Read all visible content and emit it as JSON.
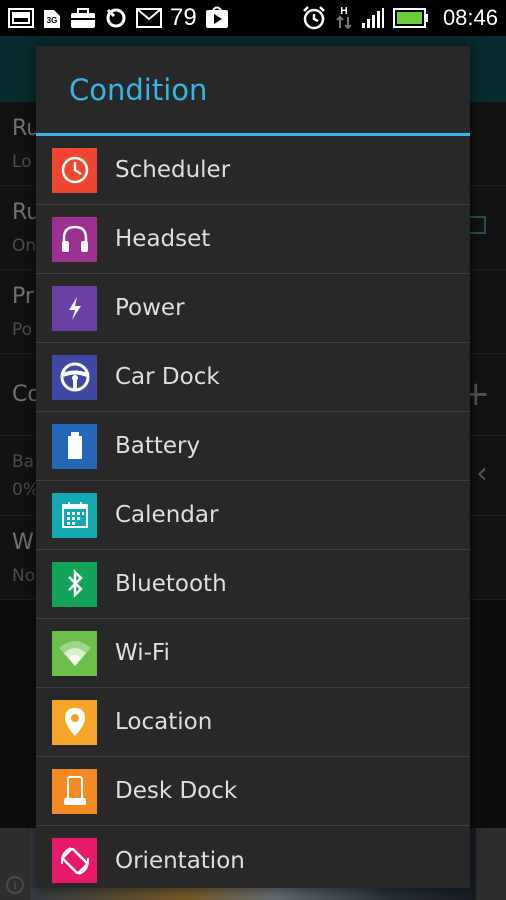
{
  "statusbar": {
    "notification_count": "79",
    "time": "08:46",
    "network_badge": "3G",
    "hspa_label": "H"
  },
  "background": {
    "rows": [
      {
        "title": "Ru",
        "sub": "Lo"
      },
      {
        "title": "Ru",
        "sub": "On"
      },
      {
        "title": "Pr",
        "sub": "Po"
      },
      {
        "title": "Co",
        "sub": ""
      },
      {
        "title": "Ba",
        "sub": "0%"
      },
      {
        "title": "W",
        "sub": "No"
      }
    ]
  },
  "dialog": {
    "title": "Condition",
    "options": [
      {
        "label": "Scheduler",
        "icon": "clock-icon",
        "color": "#f0452f"
      },
      {
        "label": "Headset",
        "icon": "headphones-icon",
        "color": "#9c2f8f"
      },
      {
        "label": "Power",
        "icon": "lightning-icon",
        "color": "#6a3fa3"
      },
      {
        "label": "Car Dock",
        "icon": "steering-wheel-icon",
        "color": "#3f49a3"
      },
      {
        "label": "Battery",
        "icon": "battery-icon",
        "color": "#2466b8"
      },
      {
        "label": "Calendar",
        "icon": "calendar-icon",
        "color": "#13a9b3"
      },
      {
        "label": "Bluetooth",
        "icon": "bluetooth-icon",
        "color": "#12a55a"
      },
      {
        "label": "Wi-Fi",
        "icon": "wifi-icon",
        "color": "#6cc04a"
      },
      {
        "label": "Location",
        "icon": "location-pin-icon",
        "color": "#f7a52a"
      },
      {
        "label": "Desk Dock",
        "icon": "desk-dock-icon",
        "color": "#f68a22"
      },
      {
        "label": "Orientation",
        "icon": "rotate-icon",
        "color": "#e8196a"
      }
    ]
  },
  "colors": {
    "accent": "#33b5e5",
    "dialog_bg": "#282828",
    "appbar": "#0e4f56"
  }
}
